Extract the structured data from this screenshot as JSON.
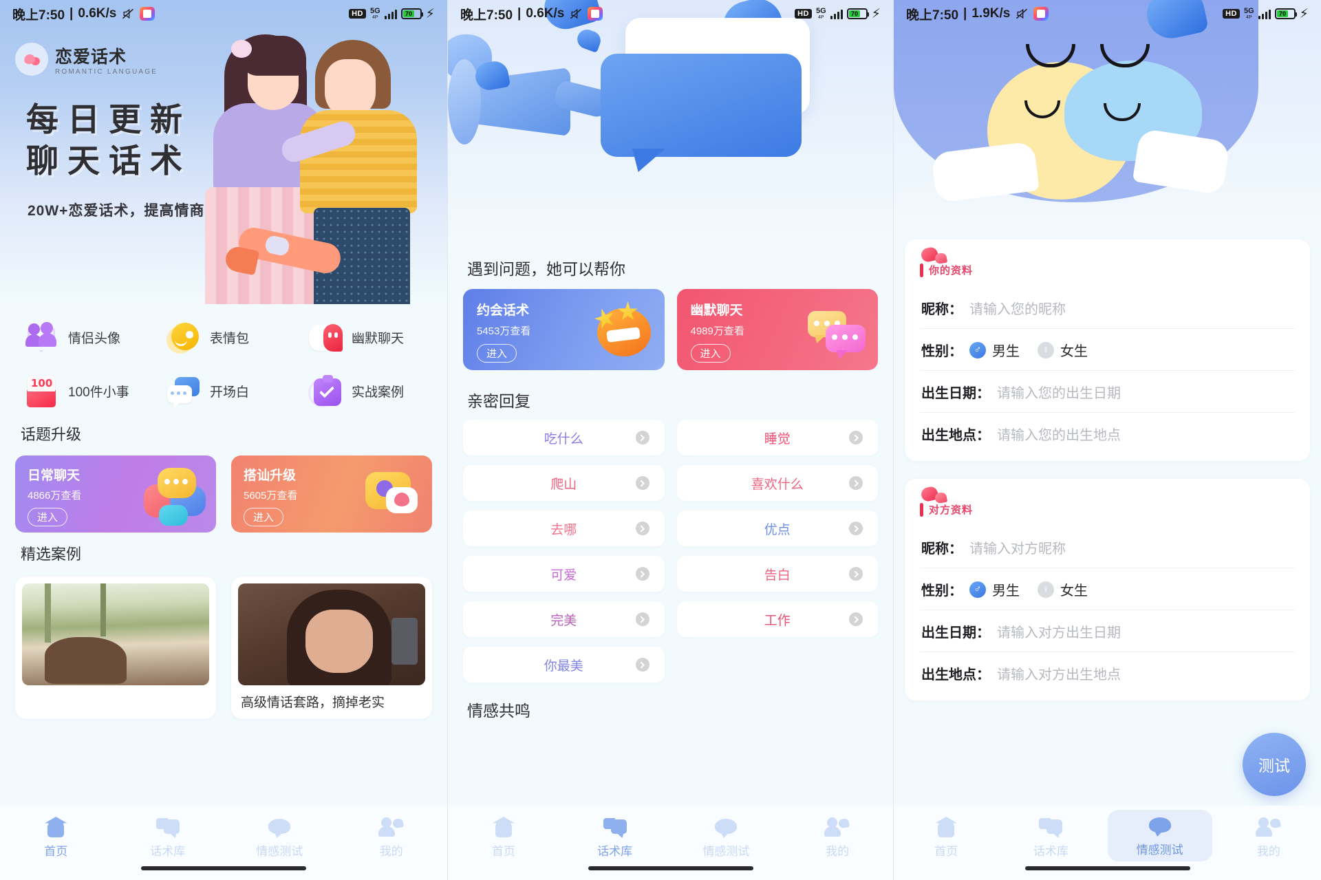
{
  "status_bars": [
    {
      "time": "晚上7:50",
      "speed": "0.6K/s",
      "hd": "HD",
      "net": "5G",
      "battery": "70"
    },
    {
      "time": "晚上7:50",
      "speed": "0.6K/s",
      "hd": "HD",
      "net": "5G",
      "battery": "70"
    },
    {
      "time": "晚上7:50",
      "speed": "1.9K/s",
      "hd": "HD",
      "net": "5G",
      "battery": "70"
    }
  ],
  "screen1": {
    "brand": {
      "name": "恋爱话术",
      "subtitle": "ROMANTIC LANGUAGE"
    },
    "hero": {
      "line1": "每日更新",
      "line2": "聊天话术",
      "sub": "20W+恋爱话术，提高情商"
    },
    "quick_icons": [
      {
        "label": "情侣头像",
        "icon": "couple-avatar-icon"
      },
      {
        "label": "表情包",
        "icon": "emoji-pack-icon"
      },
      {
        "label": "幽默聊天",
        "icon": "humor-chat-icon"
      },
      {
        "label": "100件小事",
        "icon": "hundred-things-icon"
      },
      {
        "label": "开场白",
        "icon": "opening-line-icon"
      },
      {
        "label": "实战案例",
        "icon": "case-study-icon"
      }
    ],
    "topic_section_title": "话题升级",
    "topic_cards": [
      {
        "title": "日常聊天",
        "views": "4866万查看",
        "button": "进入",
        "color": "#a88cf0"
      },
      {
        "title": "搭讪升级",
        "views": "5605万查看",
        "button": "进入",
        "color": "#f2856f"
      }
    ],
    "case_section_title": "精选案例",
    "cases": [
      {
        "caption": ""
      },
      {
        "caption": "高级情话套路，摘掉老实"
      }
    ],
    "tabs": [
      {
        "label": "首页",
        "icon": "home-icon",
        "state": "active"
      },
      {
        "label": "话术库",
        "icon": "library-icon",
        "state": "dim"
      },
      {
        "label": "情感测试",
        "icon": "test-icon",
        "state": "dim"
      },
      {
        "label": "我的",
        "icon": "profile-icon",
        "state": "dim"
      }
    ]
  },
  "screen2": {
    "section1_title": "遇到问题，她可以帮你",
    "feature_cards": [
      {
        "title": "约会话术",
        "views": "5453万查看",
        "button": "进入",
        "color": "#6a86ea"
      },
      {
        "title": "幽默聊天",
        "views": "4989万查看",
        "button": "进入",
        "color": "#f2566f"
      }
    ],
    "section2_title": "亲密回复",
    "reply_left": [
      {
        "label": "吃什么",
        "color": "#8a7ce8"
      },
      {
        "label": "爬山",
        "color": "#f2637e"
      },
      {
        "label": "去哪",
        "color": "#f3718a"
      },
      {
        "label": "可爱",
        "color": "#c56ad0"
      },
      {
        "label": "完美",
        "color": "#b85fb9"
      },
      {
        "label": "你最美",
        "color": "#7f86e2"
      }
    ],
    "reply_right": [
      {
        "label": "睡觉",
        "color": "#ef4f73"
      },
      {
        "label": "喜欢什么",
        "color": "#f2637e"
      },
      {
        "label": "优点",
        "color": "#6f8ee8"
      },
      {
        "label": "告白",
        "color": "#f2637e"
      },
      {
        "label": "工作",
        "color": "#ef4f73"
      }
    ],
    "section3_title": "情感共鸣",
    "tabs": [
      {
        "label": "首页",
        "icon": "home-icon",
        "state": "dim"
      },
      {
        "label": "话术库",
        "icon": "library-icon",
        "state": "active"
      },
      {
        "label": "情感测试",
        "icon": "test-icon",
        "state": "dim"
      },
      {
        "label": "我的",
        "icon": "profile-icon",
        "state": "dim"
      }
    ]
  },
  "screen3": {
    "self_card": {
      "header": "你的资料",
      "rows": [
        {
          "key": "昵称：",
          "value": "请输入您的昵称",
          "type": "input"
        },
        {
          "key": "性别：",
          "type": "gender",
          "options": [
            {
              "label": "男生",
              "icon": "male-icon",
              "selected": true
            },
            {
              "label": "女生",
              "icon": "female-icon",
              "selected": false
            }
          ]
        },
        {
          "key": "出生日期：",
          "value": "请输入您的出生日期",
          "type": "input"
        },
        {
          "key": "出生地点：",
          "value": "请输入您的出生地点",
          "type": "input"
        }
      ]
    },
    "other_card": {
      "header": "对方资料",
      "rows": [
        {
          "key": "昵称：",
          "value": "请输入对方昵称",
          "type": "input"
        },
        {
          "key": "性别：",
          "type": "gender",
          "options": [
            {
              "label": "男生",
              "icon": "male-icon",
              "selected": true
            },
            {
              "label": "女生",
              "icon": "female-icon",
              "selected": false
            }
          ]
        },
        {
          "key": "出生日期：",
          "value": "请输入对方出生日期",
          "type": "input"
        },
        {
          "key": "出生地点：",
          "value": "请输入对方出生地点",
          "type": "input"
        }
      ]
    },
    "fab_label": "测试",
    "tabs": [
      {
        "label": "首页",
        "icon": "home-icon",
        "state": "dim"
      },
      {
        "label": "话术库",
        "icon": "library-icon",
        "state": "dim"
      },
      {
        "label": "情感测试",
        "icon": "test-icon",
        "state": "pill"
      },
      {
        "label": "我的",
        "icon": "profile-icon",
        "state": "dim"
      }
    ]
  },
  "symbols": {
    "male": "♂",
    "female": "♀"
  }
}
